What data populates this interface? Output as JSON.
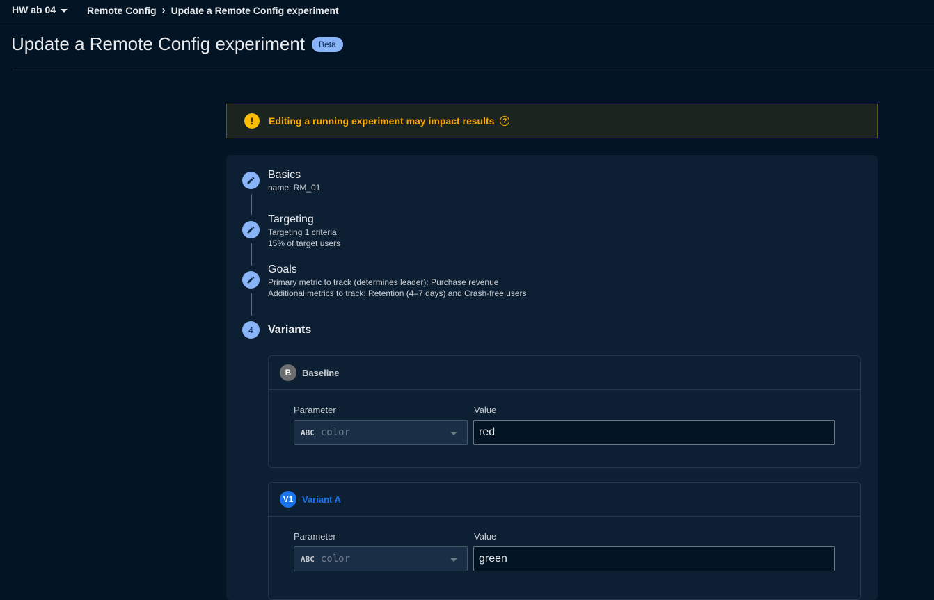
{
  "topbar": {
    "project": "HW ab 04",
    "breadcrumbs": [
      "Remote Config",
      "Update a Remote Config experiment"
    ]
  },
  "page": {
    "title": "Update a Remote Config experiment",
    "badge": "Beta"
  },
  "warning": {
    "text": "Editing a running experiment may impact results",
    "icon": "exclamation-icon",
    "help_icon": "help-icon",
    "color": "#f9ab00"
  },
  "steps": [
    {
      "title": "Basics",
      "icon": "edit-icon",
      "details": [
        "name: RM_01"
      ]
    },
    {
      "title": "Targeting",
      "icon": "edit-icon",
      "details": [
        "Targeting 1 criteria",
        "15% of target users"
      ]
    },
    {
      "title": "Goals",
      "icon": "edit-icon",
      "details": [
        "Primary metric to track (determines leader): Purchase revenue",
        "Additional metrics to track: Retention (4–7 days) and Crash-free users"
      ]
    },
    {
      "number": "4",
      "title": "Variants"
    }
  ],
  "variants": [
    {
      "badge": "B",
      "name": "Baseline",
      "badge_color": "#6e6e6e",
      "name_color": "#c9cdd2",
      "parameter_label": "Parameter",
      "value_label": "Value",
      "parameter_type": "ABC",
      "parameter_name": "color",
      "value": "red"
    },
    {
      "badge": "V1",
      "name": "Variant A",
      "badge_color": "#1a73e8",
      "name_color": "#1a73e8",
      "parameter_label": "Parameter",
      "value_label": "Value",
      "parameter_type": "ABC",
      "parameter_name": "color",
      "value": "green"
    }
  ]
}
